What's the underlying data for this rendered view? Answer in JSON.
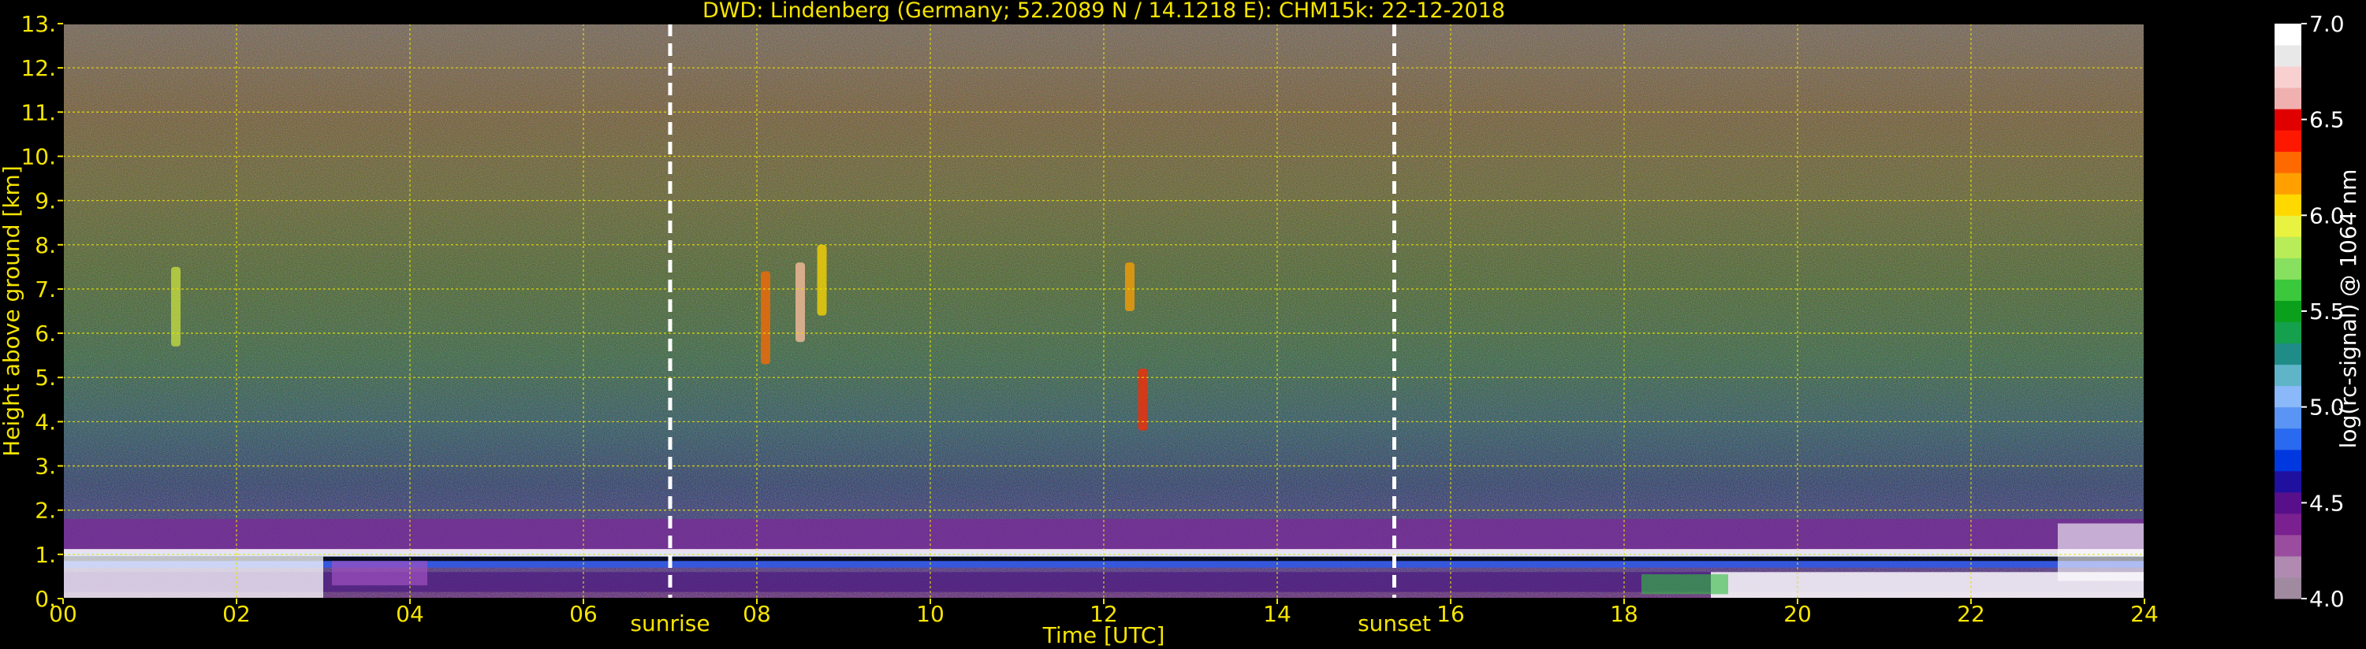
{
  "chart_data": {
    "type": "heatmap",
    "title": "DWD: Lindenberg (Germany; 52.2089 N / 14.1218 E):    CHM15k: 22-12-2018",
    "xlabel": "Time [UTC]",
    "ylabel": "Height above ground [km]",
    "xlim": [
      0,
      24
    ],
    "ylim": [
      0,
      13
    ],
    "x_ticks": [
      0,
      2,
      4,
      6,
      8,
      10,
      12,
      14,
      16,
      18,
      20,
      22,
      24
    ],
    "x_tick_labels": [
      "00",
      "02",
      "04",
      "06",
      "08",
      "10",
      "12",
      "14",
      "16",
      "18",
      "20",
      "22",
      "24"
    ],
    "y_ticks": [
      0,
      1,
      2,
      3,
      4,
      5,
      6,
      7,
      8,
      9,
      10,
      11,
      12,
      13
    ],
    "y_tick_labels": [
      "0.",
      "1.",
      "2.",
      "3.",
      "4.",
      "5.",
      "6.",
      "7.",
      "8.",
      "9.",
      "10.",
      "11.",
      "12.",
      "13."
    ],
    "grid": true,
    "events": [
      {
        "label": "sunrise",
        "time": 7.0
      },
      {
        "label": "sunset",
        "time": 15.35
      }
    ],
    "colorbar": {
      "label": "log(rc-signal) @ 1064 nm",
      "range": [
        4.0,
        7.0
      ],
      "ticks": [
        4.0,
        4.5,
        5.0,
        5.5,
        6.0,
        6.5,
        7.0
      ],
      "tick_labels": [
        "4.0",
        "4.5",
        "5.0",
        "5.5",
        "6.0",
        "6.5",
        "7.0"
      ],
      "colors": [
        "#a08aa0",
        "#b08ab0",
        "#9a4d9e",
        "#7a2090",
        "#58108a",
        "#2010a0",
        "#0038e0",
        "#2a6af0",
        "#5a94f4",
        "#8ab8f8",
        "#60b4c8",
        "#208c88",
        "#14a04c",
        "#0aa01c",
        "#3cc83c",
        "#88e060",
        "#b8ec58",
        "#e8f240",
        "#ffd800",
        "#ffa000",
        "#ff6a00",
        "#ff1800",
        "#e00000",
        "#f0b0b0",
        "#f8d0d0",
        "#e8e8e8",
        "#ffffff"
      ]
    }
  }
}
